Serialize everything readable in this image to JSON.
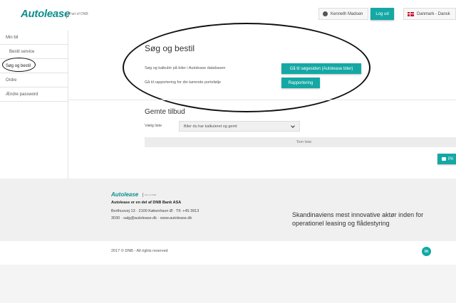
{
  "header": {
    "logo": "Autolease",
    "logo_sub": "Part of DNB",
    "user_name": "Kenneth Madsen",
    "logout_label": "Log ud",
    "country_label": "Danmark - Dansk"
  },
  "sidebar": {
    "items": [
      {
        "label": "Min bil"
      },
      {
        "label": "Bestil service"
      },
      {
        "label": "Søg og bestil"
      },
      {
        "label": "Ordre"
      },
      {
        "label": "Ændre password"
      }
    ]
  },
  "main": {
    "title": "Søg og bestil",
    "row1_label": "Søg og kalkulér på biler i Autolease databasen",
    "row1_button": "Gå til søgesiden (Autolease biler)",
    "row2_label": "Gå til rapportering for din kørende portefølje",
    "row2_button": "Rapportering",
    "saved_title": "Gemte tilbud",
    "select_label": "Vælg liste",
    "select_value": "Biler du har kalkuleret og gemt",
    "empty_list": "Tom liste",
    "print_label": "Pri"
  },
  "footer": {
    "logo": "Autolease",
    "line1": "Autolease er en del af DNB Bank ASA",
    "line2": "Borthusvej 13 · 2100 København Ø · Tlf. +45 3913",
    "line3": "3030 · salg@autolease.dk · www.autolease.dk",
    "tagline": "Skandinaviens mest innovative aktør inden for operationel leasing og flådestyring",
    "copyright": "2017 © DNB - All rights reserved",
    "linkedin": "in"
  },
  "colors": {
    "accent": "#14a8a4",
    "brand": "#0b8f8c"
  }
}
